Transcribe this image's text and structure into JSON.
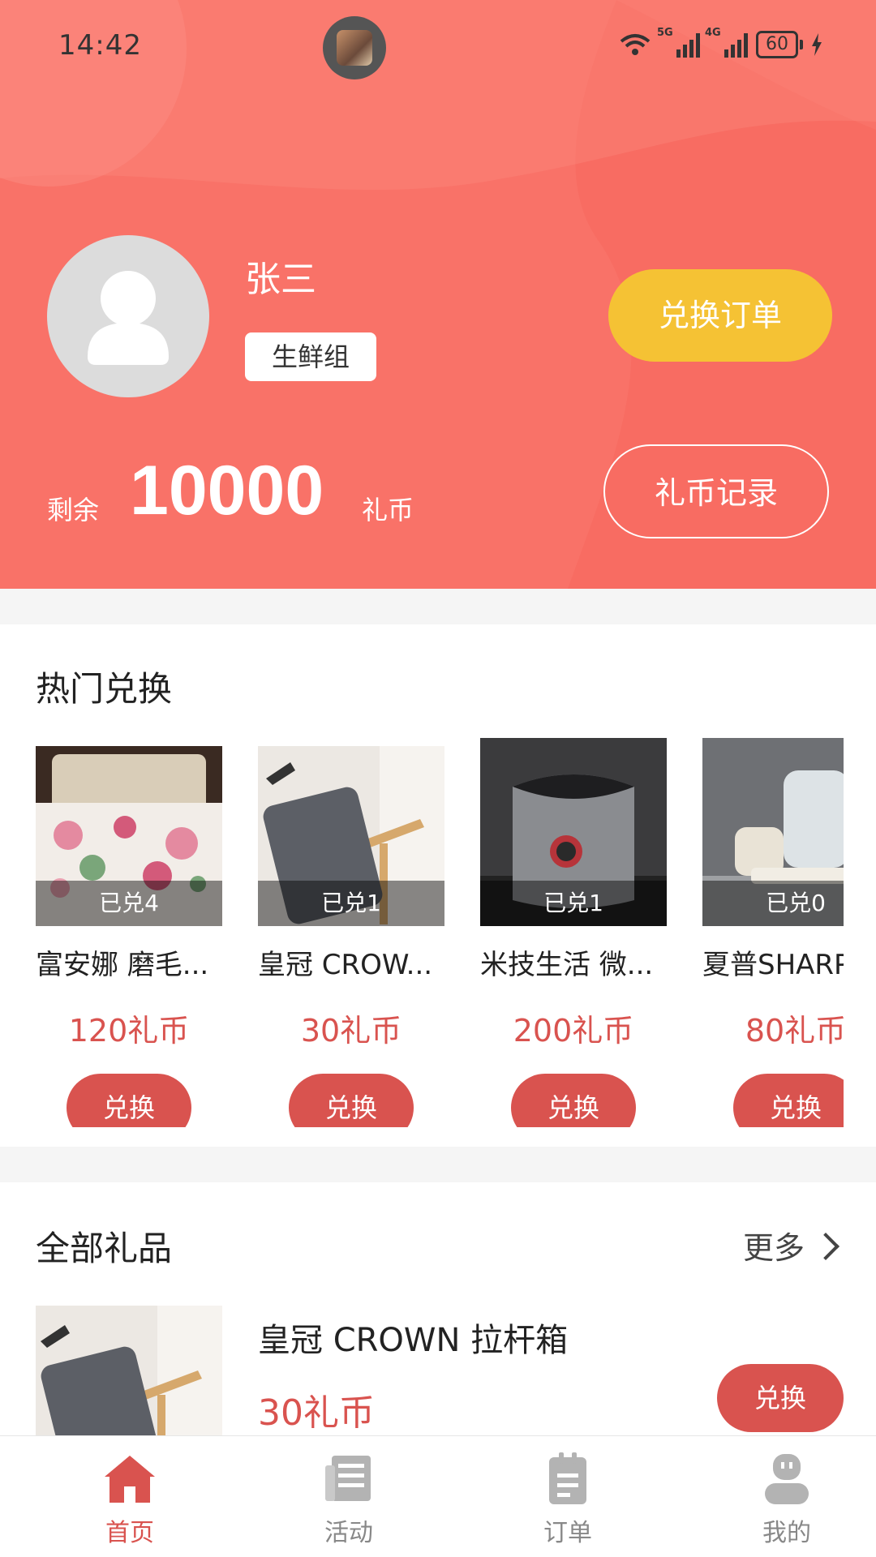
{
  "status_bar": {
    "time": "14:42",
    "signal1_label": "5G",
    "signal2_label": "4G",
    "battery": "60"
  },
  "profile": {
    "name": "张三",
    "group": "生鲜组",
    "balance_label": "剩余",
    "balance": "10000",
    "balance_unit": "礼币",
    "orders_button": "兑换订单",
    "records_button": "礼币记录"
  },
  "hot": {
    "title": "热门兑换",
    "items": [
      {
        "name": "富安娜 磨毛...",
        "badge": "已兑4",
        "price": "120礼币",
        "button": "兑换"
      },
      {
        "name": "皇冠 CROW...",
        "badge": "已兑1",
        "price": "30礼币",
        "button": "兑换"
      },
      {
        "name": "米技生活 微...",
        "badge": "已兑1",
        "price": "200礼币",
        "button": "兑换"
      },
      {
        "name": "夏普SHARP",
        "badge": "已兑0",
        "price": "80礼币",
        "button": "兑换"
      }
    ]
  },
  "all_gifts": {
    "title": "全部礼品",
    "more": "更多",
    "items": [
      {
        "name": "皇冠 CROWN 拉杆箱",
        "price": "30礼币",
        "button": "兑换"
      }
    ]
  },
  "nav": {
    "items": [
      {
        "label": "首页",
        "icon": "home-icon",
        "active": true
      },
      {
        "label": "活动",
        "icon": "news-icon",
        "active": false
      },
      {
        "label": "订单",
        "icon": "clipboard-icon",
        "active": false
      },
      {
        "label": "我的",
        "icon": "user-icon",
        "active": false
      }
    ]
  },
  "colors": {
    "header_bg": "#f97268",
    "accent_red": "#d9534f",
    "orders_button_bg": "#f5c234"
  }
}
